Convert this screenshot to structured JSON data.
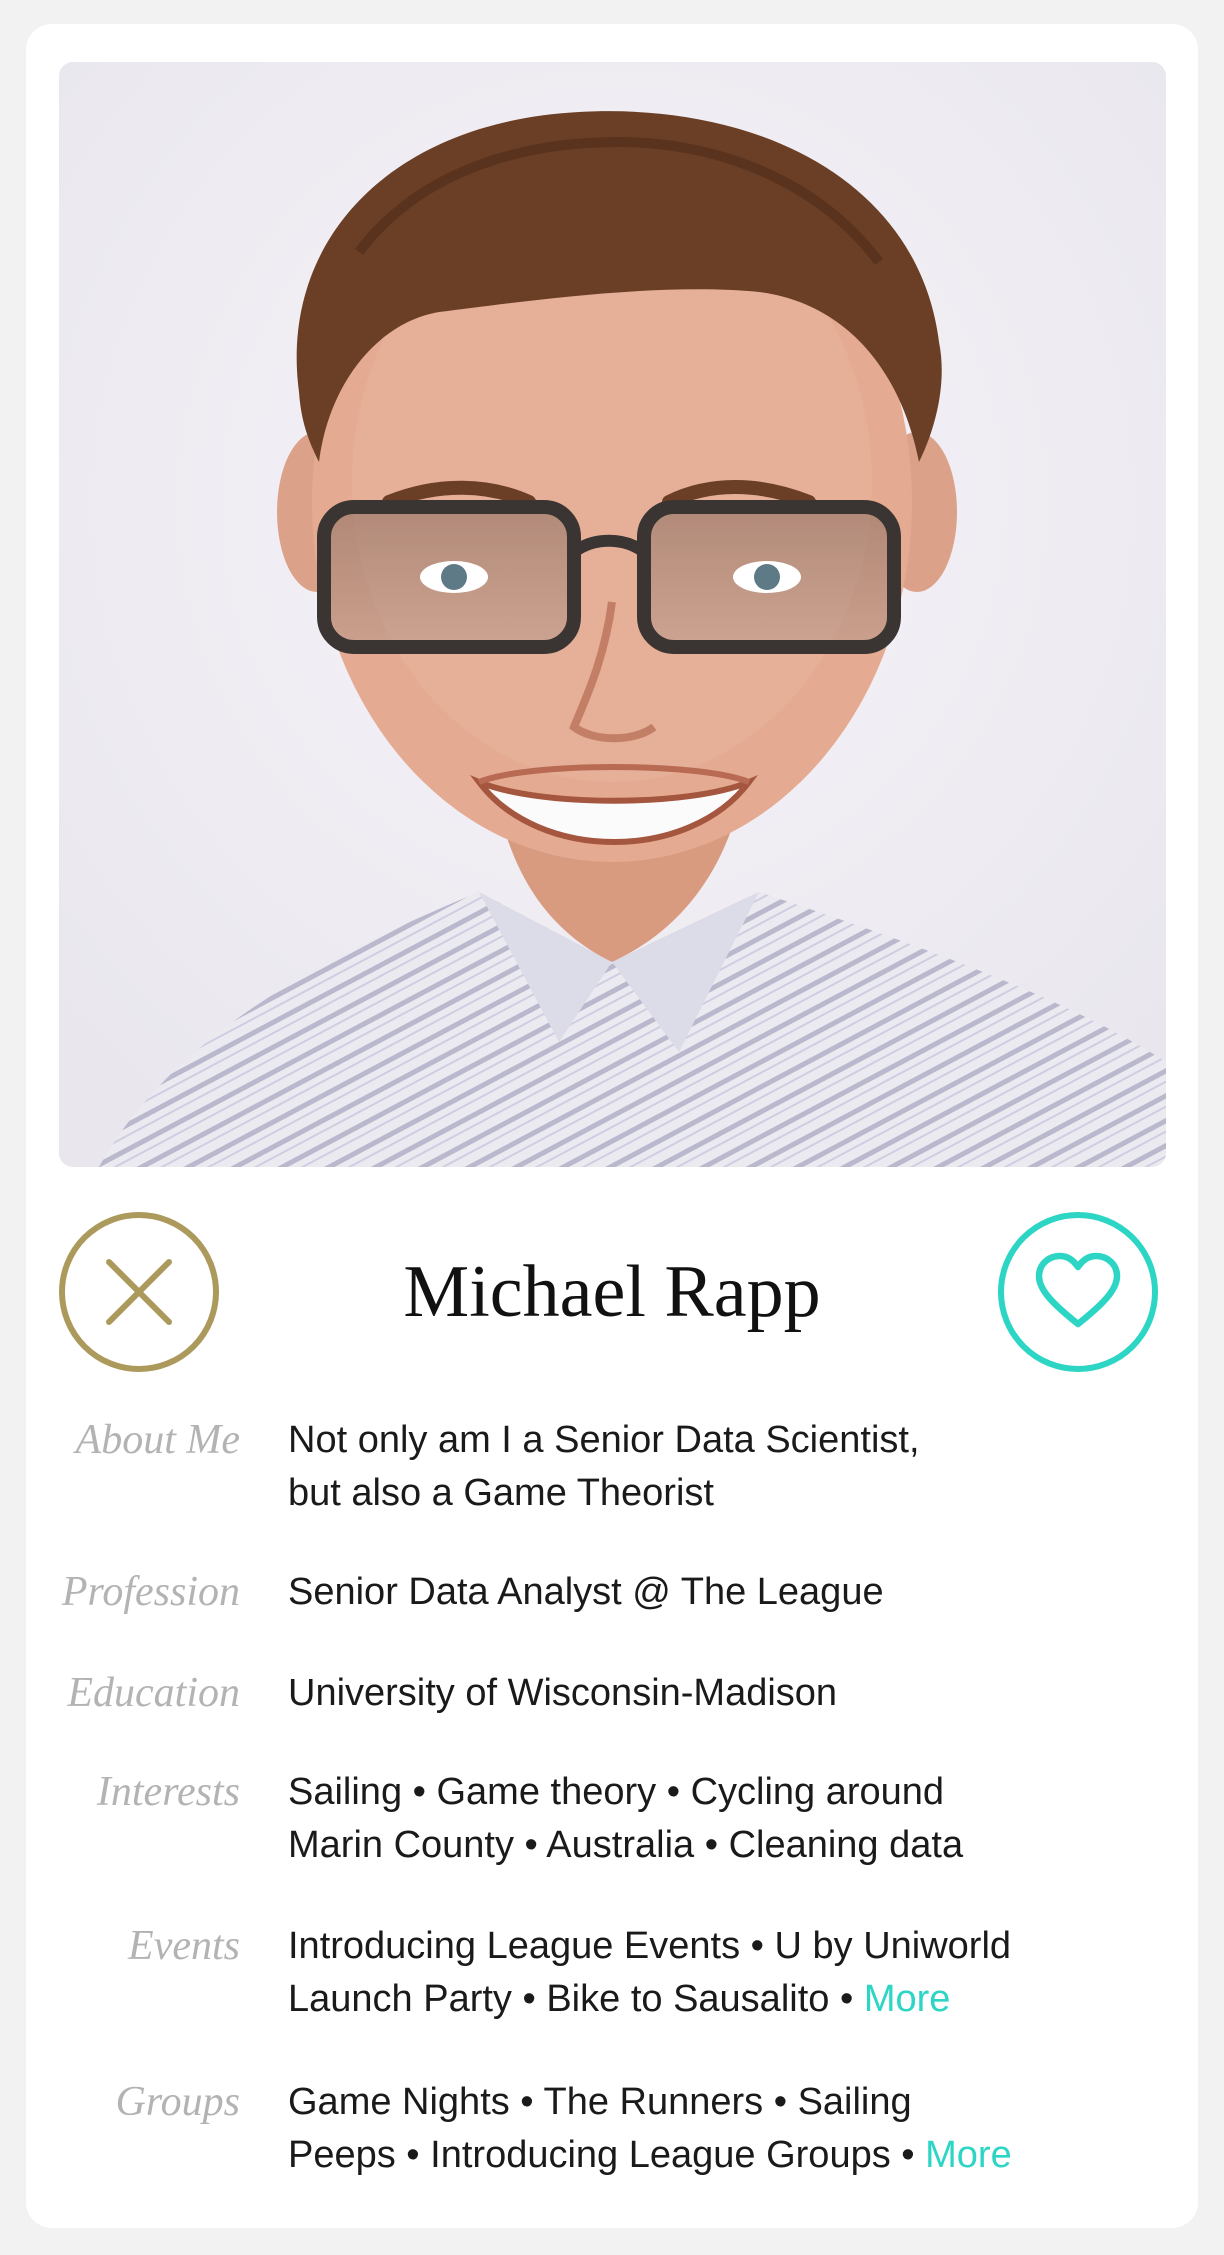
{
  "profile": {
    "name": "Michael Rapp",
    "fields": {
      "about": {
        "label": "About Me",
        "lines": [
          "Not only am I a Senior Data Scientist,",
          "but also a Game Theorist"
        ]
      },
      "profession": {
        "label": "Profession",
        "lines": [
          "Senior Data Analyst @ The League"
        ]
      },
      "education": {
        "label": "Education",
        "lines": [
          "University of Wisconsin-Madison"
        ]
      },
      "interests": {
        "label": "Interests",
        "lines": [
          "Sailing • Game theory • Cycling around",
          "Marin County • Australia • Cleaning data"
        ]
      },
      "events": {
        "label": "Events",
        "lines": [
          "Introducing League Events • U by Uniworld",
          "Launch Party • Bike to Sausalito • "
        ],
        "more": "More"
      },
      "groups": {
        "label": "Groups",
        "lines": [
          "Game Nights • The Runners • Sailing",
          "Peeps • Introducing League Groups • "
        ],
        "more": "More"
      }
    }
  },
  "actions": {
    "pass_icon": "close-icon",
    "like_icon": "heart-icon"
  },
  "colors": {
    "pass_accent": "#ac9a5c",
    "like_accent": "#2cd5c4",
    "label_gray": "#b3b3b3"
  }
}
